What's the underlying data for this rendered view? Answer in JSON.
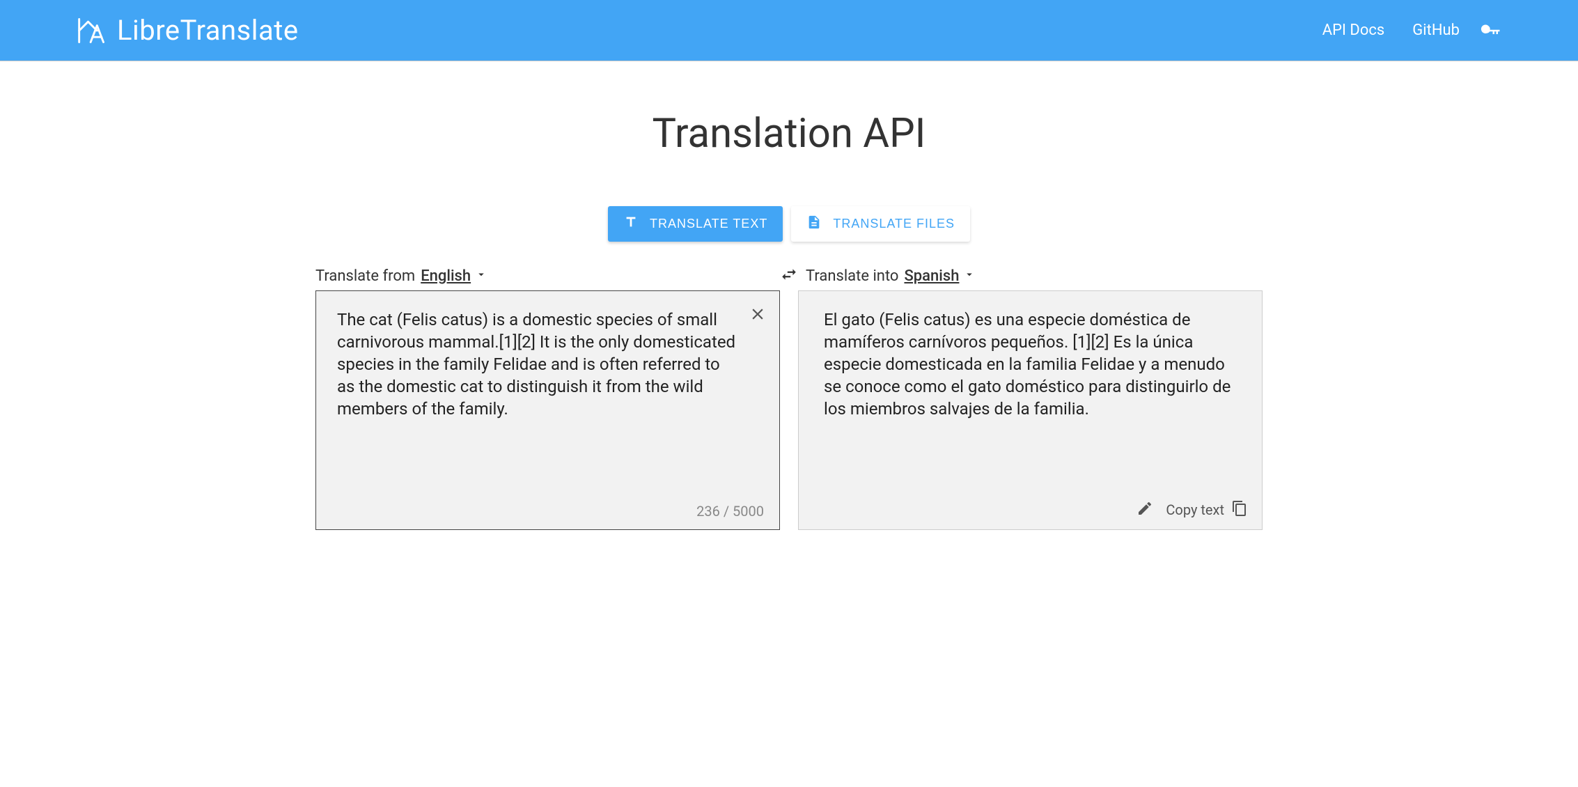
{
  "nav": {
    "brand": "LibreTranslate",
    "links": {
      "api_docs": "API Docs",
      "github": "GitHub"
    }
  },
  "page": {
    "title": "Translation API"
  },
  "tabs": {
    "text": "TRANSLATE TEXT",
    "files": "TRANSLATE FILES"
  },
  "lang": {
    "from_label": "Translate from",
    "from_value": "English",
    "into_label": "Translate into",
    "into_value": "Spanish"
  },
  "source": {
    "text": "The cat (Felis catus) is a domestic species of small carnivorous mammal.[1][2] It is the only domesticated species in the family Felidae and is often referred to as the domestic cat to distinguish it from the wild members of the family.",
    "char_count": "236 / 5000"
  },
  "target": {
    "text": "El gato (Felis catus) es una especie doméstica de mamíferos carnívoros pequeños. [1][2] Es la única especie domesticada en la familia Felidae y a menudo se conoce como el gato doméstico para distinguirlo de los miembros salvajes de la familia.",
    "copy_label": "Copy text"
  }
}
